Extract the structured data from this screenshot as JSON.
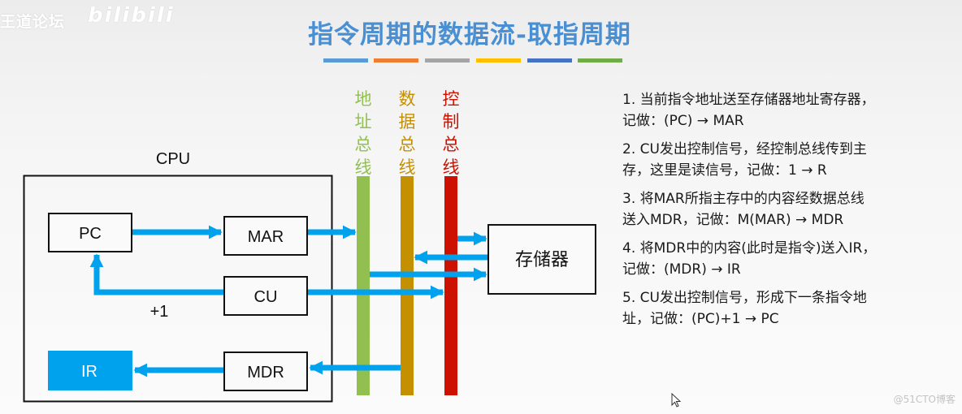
{
  "watermark": {
    "site": "王道论坛",
    "logo": "bilibili",
    "footer": "@51CTO博客"
  },
  "header": {
    "title": "指令周期的数据流-取指周期",
    "title_color": "#4a8fd2",
    "decor_bar_colors": [
      "#5b9bd5",
      "#ed7d31",
      "#a5a5a5",
      "#ffc000",
      "#4472c4",
      "#70ad47"
    ]
  },
  "diagram": {
    "cpu_label": "CPU",
    "registers": {
      "pc": "PC",
      "mar": "MAR",
      "cu": "CU",
      "mdr": "MDR",
      "ir": "IR"
    },
    "increment_label": "+1",
    "memory_label": "存储器",
    "arrow_color": "#00a2ed",
    "ir_fill_color": "#00a2ed",
    "buses": [
      {
        "label_chars": [
          "地",
          "址",
          "总",
          "线"
        ],
        "name": "地址总线",
        "color": "#92c050"
      },
      {
        "label_chars": [
          "数",
          "据",
          "总",
          "线"
        ],
        "name": "数据总线",
        "color": "#c59000"
      },
      {
        "label_chars": [
          "控",
          "制",
          "总",
          "线"
        ],
        "name": "控制总线",
        "color": "#cc1100"
      }
    ]
  },
  "steps": [
    {
      "lines": [
        "1. 当前指令地址送至存储器地址寄存器，",
        "记做：(PC) → MAR"
      ]
    },
    {
      "lines": [
        "2. CU发出控制信号，经控制总线传到主",
        "存，这里是读信号，记做：1 → R"
      ]
    },
    {
      "lines": [
        "3. 将MAR所指主存中的内容经数据总线",
        "送入MDR，记做：M(MAR) → MDR"
      ]
    },
    {
      "lines": [
        "4. 将MDR中的内容(此时是指令)送入IR，",
        "记做：(MDR) → IR"
      ]
    },
    {
      "lines": [
        "5. CU发出控制信号，形成下一条指令地",
        "址，记做：(PC)+1 → PC"
      ]
    }
  ]
}
